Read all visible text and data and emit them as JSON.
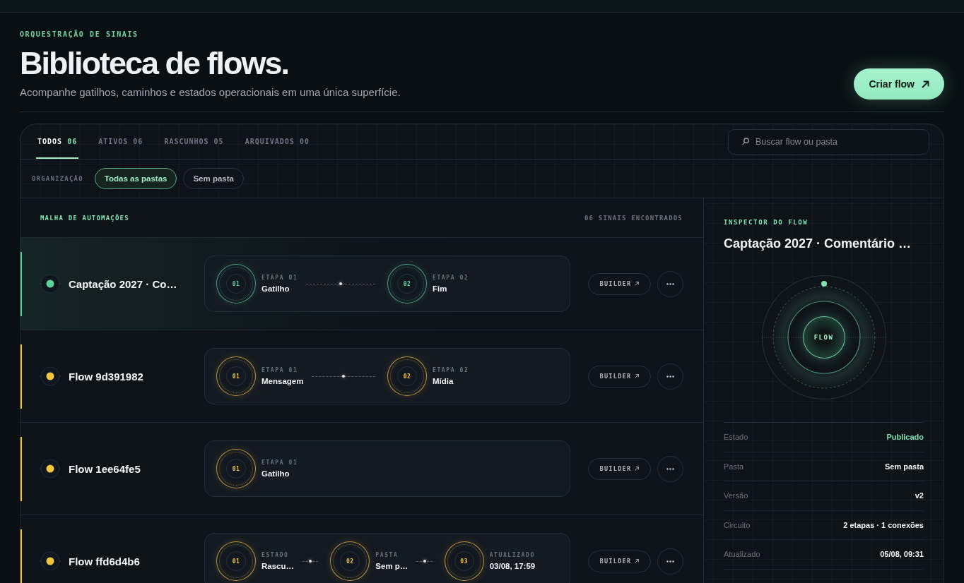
{
  "header": {
    "eyebrow": "ORQUESTRAÇÃO DE SINAIS",
    "title": "Biblioteca de flows.",
    "subtitle": "Acompanhe gatilhos, caminhos e estados operacionais em uma única superfície.",
    "action": {
      "label": "Criar flow"
    }
  },
  "tabs": [
    {
      "label": "TODOS",
      "count": "06",
      "selected": true
    },
    {
      "label": "ATIVOS",
      "count": "06",
      "selected": false
    },
    {
      "label": "RASCUNHOS",
      "count": "05",
      "selected": false
    },
    {
      "label": "ARQUIVADOS",
      "count": "00",
      "selected": false
    }
  ],
  "search": {
    "placeholder": "Buscar flow ou pasta"
  },
  "filters": {
    "label": "ORGANIZAÇÃO",
    "chips": [
      {
        "label": "Todas as pastas",
        "selected": true
      },
      {
        "label": "Sem pasta",
        "selected": false
      }
    ]
  },
  "list": {
    "title": "MALHA DE AUTOMAÇÕES",
    "count": "06 SINAIS ENCONTRADOS",
    "flows": [
      {
        "name": "Captação 2027 · Co…",
        "selected": true,
        "color": "#5dd39e",
        "steps": [
          {
            "number": "01",
            "label": "ETAPA 01",
            "value": "Gatilho"
          },
          {
            "number": "02",
            "label": "ETAPA 02",
            "value": "Fim"
          }
        ],
        "action": "BUILDER"
      },
      {
        "name": "Flow 9d391982",
        "selected": false,
        "color": "#f5c542",
        "steps": [
          {
            "number": "01",
            "label": "ETAPA 01",
            "value": "Mensagem"
          },
          {
            "number": "02",
            "label": "ETAPA 02",
            "value": "Mídia"
          }
        ],
        "action": "BUILDER"
      },
      {
        "name": "Flow 1ee64fe5",
        "selected": false,
        "color": "#f5c542",
        "steps": [
          {
            "number": "01",
            "label": "ETAPA 01",
            "value": "Gatilho"
          }
        ],
        "action": "BUILDER"
      },
      {
        "name": "Flow ffd6d4b6",
        "selected": false,
        "color": "#f5c542",
        "steps": [
          {
            "number": "01",
            "label": "ESTADO",
            "value": "Rascu…"
          },
          {
            "number": "02",
            "label": "PASTA",
            "value": "Sem p…"
          },
          {
            "number": "03",
            "label": "ATUALIZADO",
            "value": "03/08, 17:59"
          }
        ],
        "action": "BUILDER"
      }
    ]
  },
  "inspector": {
    "eyebrow": "INSPECTOR DO FLOW",
    "title": "Captação 2027 · Comentário …",
    "core_label": "FLOW",
    "details": [
      {
        "label": "Estado",
        "value": "Publicado",
        "kind": "status"
      },
      {
        "label": "Pasta",
        "value": "Sem pasta",
        "kind": "text"
      },
      {
        "label": "Versão",
        "value": "v2",
        "kind": "text"
      },
      {
        "label": "Circuito",
        "value": "2 etapas · 1 conexões",
        "kind": "text"
      },
      {
        "label": "Atualizado",
        "value": "05/08, 09:31",
        "kind": "text"
      }
    ]
  }
}
